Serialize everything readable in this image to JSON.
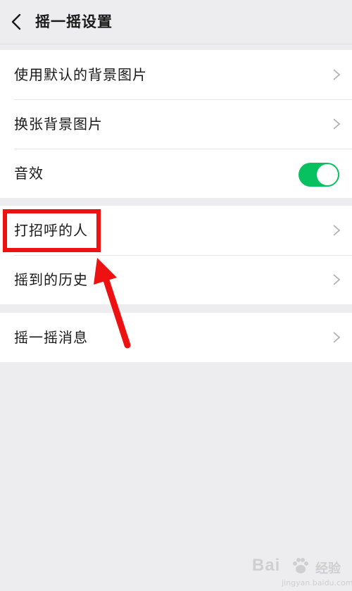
{
  "header": {
    "title": "摇一摇设置",
    "back_icon": "chevron-left-icon"
  },
  "groups": [
    {
      "rows": [
        {
          "label": "使用默认的背景图片",
          "control": "chevron"
        },
        {
          "label": "换张背景图片",
          "control": "chevron"
        },
        {
          "label": "音效",
          "control": "toggle",
          "toggle_on": true
        }
      ]
    },
    {
      "rows": [
        {
          "label": "打招呼的人",
          "control": "chevron",
          "highlighted": true
        },
        {
          "label": "摇到的历史",
          "control": "chevron"
        }
      ]
    },
    {
      "rows": [
        {
          "label": "摇一摇消息",
          "control": "chevron"
        }
      ]
    }
  ],
  "colors": {
    "toggle_on": "#07c160",
    "annotation": "#ee1111",
    "background": "#ededef"
  },
  "watermark": {
    "brand": "Bai",
    "suffix": "经验",
    "url": "jingyan.baidu.com"
  }
}
